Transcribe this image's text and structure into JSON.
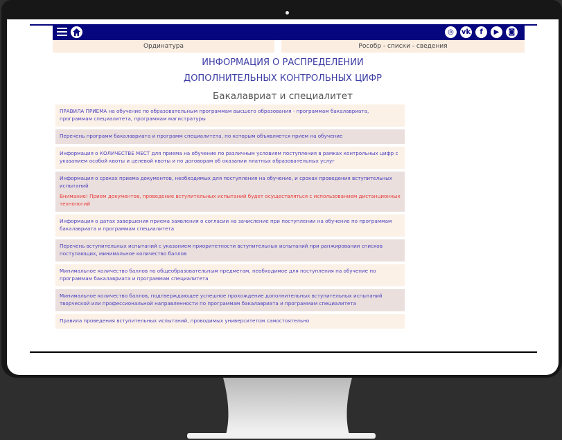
{
  "nav": {
    "left_label": "Ординатура",
    "right_label": "Рособр - списки - сведения"
  },
  "social_icons": [
    "instagram-icon",
    "vk-icon",
    "facebook-icon",
    "youtube-icon",
    "rss-icon"
  ],
  "social_glyphs": [
    "◎",
    "vk",
    "f",
    "▶",
    "◙"
  ],
  "heading": {
    "line1": "ИНФОРМАЦИЯ О РАСПРЕДЕЛЕНИИ",
    "line2": "ДОПОЛНИТЕЛЬНЫХ КОНТРОЛЬНЫХ ЦИФР"
  },
  "subtitle": "Бакалавриат и специалитет",
  "rows": [
    {
      "text": "ПРАВИЛА ПРИЕМА на обучение по образовательным программам высшего образования - программам бакалавриата, программам специалитета, программам магистратуры"
    },
    {
      "text": "Перечень программ бакалавриата и программ специалитета, по которым объявляется прием на обучение"
    },
    {
      "text": "Информация о КОЛИЧЕСТВЕ МЕСТ для приема на обучение по различным условиям поступления в рамках контрольных цифр с указанием особой квоты и целевой квоты и по договорам об оказании платных образовательных услуг"
    },
    {
      "text": "Информация о сроках приема документов, необходимых для поступления на обучение, и сроках проведения вступительных испытаний",
      "warning": "Внимание! Прием документов, проведение вступительных испытаний будет осуществляться с использованием дистанционных технологий"
    },
    {
      "text": "Информация о датах завершения приема заявления о согласии на зачисление при поступлении на обучение по программам бакалавриата и программам специалитета"
    },
    {
      "text": "Перечень вступительных испытаний с указанием приоритетности вступительных испытаний при ранжировании списков поступающих, минимальное количество баллов"
    },
    {
      "text": "Минимальное количество баллов по общеобразовательным предметам, необходимое для поступления на обучение по программам бакалавриата и программам специалитета"
    },
    {
      "text": "Минимальное количество баллов, подтверждающее успешное прохождение дополнительных вступительных испытаний творческой или профессиональной направленности по программам бакалавриата и программам специалитета"
    },
    {
      "text": "Правила проведения вступительных испытаний, проводимых университетом самостоятельно"
    }
  ],
  "colors": {
    "topbar": "#06067e",
    "row_light": "#fbf1e7",
    "row_dark": "#eadfdc",
    "link": "#4a3ec0",
    "warning": "#ea3a3a"
  }
}
